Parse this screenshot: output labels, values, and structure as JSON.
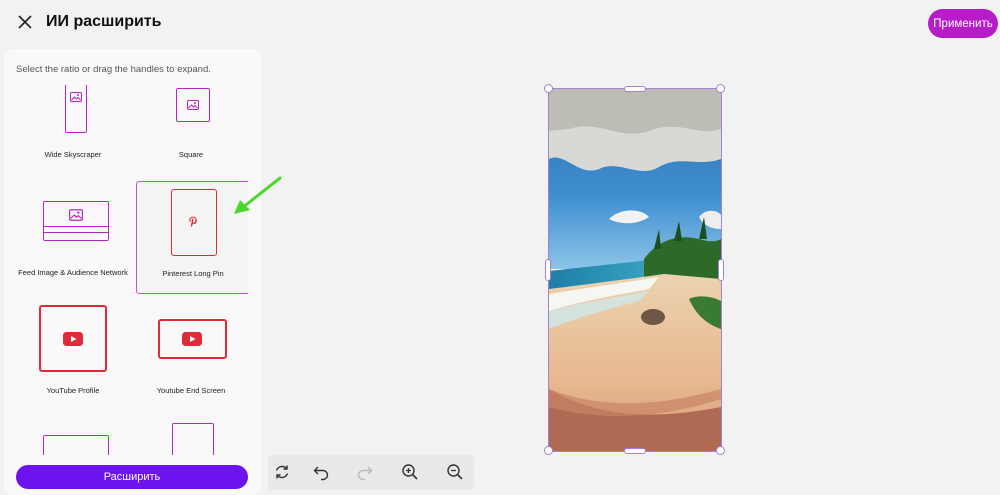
{
  "header": {
    "title": "ИИ расширить",
    "apply_label": "Применить"
  },
  "panel": {
    "hint": "Select the ratio or drag the handles to expand.",
    "expand_label": "Расширить",
    "presets": [
      {
        "label": "Wide Skyscraper"
      },
      {
        "label": "Square"
      },
      {
        "label": "Feed Image & Audience Network"
      },
      {
        "label": "Pinterest Long Pin",
        "selected": true
      },
      {
        "label": "YouTube Profile"
      },
      {
        "label": "Youtube End Screen"
      }
    ]
  },
  "toolbar": [
    "refresh-icon",
    "undo-icon",
    "redo-icon",
    "zoom-in-icon",
    "zoom-out-icon"
  ],
  "colors": {
    "accent": "#b61cc7",
    "primary": "#6d14ee",
    "selection": "#a780d6",
    "youtube_red": "#dd2b3a"
  }
}
